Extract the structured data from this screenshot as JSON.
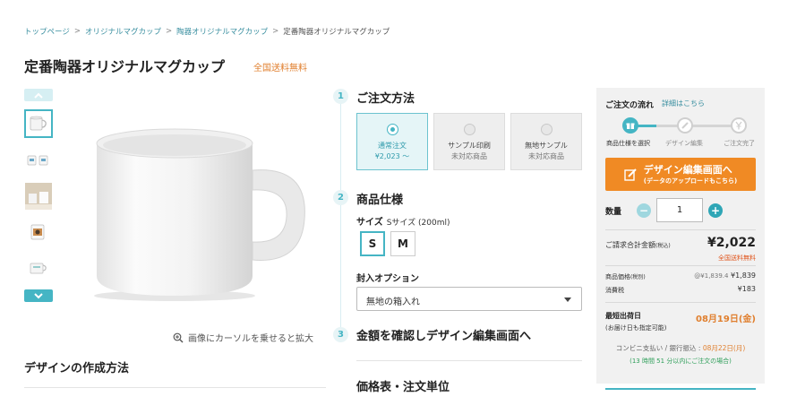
{
  "breadcrumb": {
    "items": [
      "トップページ",
      "オリジナルマグカップ",
      "陶器オリジナルマグカップ"
    ],
    "current": "定番陶器オリジナルマグカップ",
    "separator": ">"
  },
  "product": {
    "title": "定番陶器オリジナルマグカップ",
    "free_shipping": "全国送料無料",
    "zoom_hint": "画像にカーソルを乗せると拡大",
    "howto_title": "デザインの作成方法"
  },
  "steps": {
    "s1": {
      "num": "1",
      "title": "ご注文方法"
    },
    "s2": {
      "num": "2",
      "title": "商品仕様"
    },
    "s3": {
      "num": "3",
      "title": "金額を確認しデザイン編集画面へ"
    }
  },
  "order_methods": [
    {
      "name": "通常注文",
      "sub": "¥2,023 〜",
      "selected": true
    },
    {
      "name": "サンプル印刷",
      "sub": "未対応商品",
      "selected": false
    },
    {
      "name": "無地サンプル",
      "sub": "未対応商品",
      "selected": false
    }
  ],
  "spec": {
    "size_label": "サイズ",
    "size_value": "Sサイズ (200ml)",
    "sizes": [
      "S",
      "M"
    ],
    "selected_size": "S",
    "wrap_label": "封入オプション",
    "wrap_value": "無地の箱入れ"
  },
  "price_table_title": "価格表・注文単位",
  "sidebar": {
    "flow_title": "ご注文の流れ",
    "flow_link": "詳細はこちら",
    "flow_steps": [
      "商品仕様を選択",
      "デザイン編集",
      "ご注文完了"
    ],
    "design_button_line1": "デザイン編集画面へ",
    "design_button_line2": "(データのアップロードもこちら)",
    "qty_label": "数量",
    "qty_value": "1",
    "qty_minus": "−",
    "qty_plus": "+",
    "total_label": "ご請求合計金額",
    "total_label_small": "(税込)",
    "total_value": "¥2,022",
    "total_free": "全国送料無料",
    "item_price_label": "商品価格",
    "item_price_small": "(税別)",
    "item_unit": "@¥1,839.4",
    "item_price_value": "¥1,839",
    "tax_label": "消費税",
    "tax_value": "¥183",
    "ship_label": "最短出荷日",
    "ship_sub": "(お届け日も指定可能)",
    "ship_date": "08月19日(金)",
    "conv_text": "コンビニ支払い / 銀行振込 : ",
    "conv_date": "08月22日(月)",
    "conv_note": "(13 時間 51 分以内にご注文の場合)"
  },
  "colors": {
    "accent": "#45b5c4",
    "orange": "#f08a24",
    "free_ship": "#e07f2e"
  }
}
